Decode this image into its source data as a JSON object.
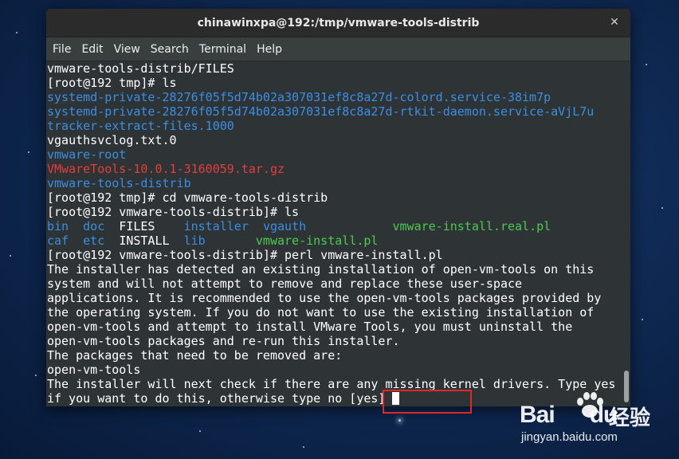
{
  "window": {
    "title": "chinawinxpa@192:/tmp/vmware-tools-distrib"
  },
  "menu": [
    "File",
    "Edit",
    "View",
    "Search",
    "Terminal",
    "Help"
  ],
  "terminal": {
    "lines": [
      "vmware-tools-distrib/FILES",
      "[root@192 tmp]# ls",
      "systemd-private-28276f05f5d74b02a307031ef8c8a27d-colord.service-38im7p",
      "systemd-private-28276f05f5d74b02a307031ef8c8a27d-rtkit-daemon.service-aVjL7u",
      "tracker-extract-files.1000",
      "vgauthsvclog.txt.0",
      "vmware-root",
      "VMwareTools-10.0.1-3160059.tar.gz",
      "vmware-tools-distrib",
      "[root@192 tmp]# cd vmware-tools-distrib",
      "[root@192 vmware-tools-distrib]# ls",
      "",
      "",
      "[root@192 vmware-tools-distrib]# perl vmware-install.pl",
      "The installer has detected an existing installation of open-vm-tools on this",
      "system and will not attempt to remove and replace these user-space",
      "applications. It is recommended to use the open-vm-tools packages provided by",
      "the operating system. If you do not want to use the existing installation of",
      "open-vm-tools and attempt to install VMware Tools, you must uninstall the",
      "open-vm-tools packages and re-run this installer.",
      "The packages that need to be removed are:",
      "open-vm-tools",
      "The installer will next check if there are any missing kernel drivers. Type yes",
      "if you want to do this, otherwise type no [yes] "
    ],
    "ls_row1": [
      "bin",
      "doc",
      "FILES",
      "installer",
      "vgauth",
      "vmware-install.real.pl"
    ],
    "ls_row2": [
      "caf",
      "etc",
      "INSTALL",
      "lib",
      "vmware-install.pl"
    ]
  },
  "watermark": {
    "logo": "Bai",
    "logo2": "du",
    "cn": "经验",
    "url": "jingyan.baidu.com"
  },
  "colors": {
    "dir": "#3b8ee3",
    "archive": "#e63c3c",
    "exec": "#4ec94e",
    "highlight": "#e02828"
  }
}
